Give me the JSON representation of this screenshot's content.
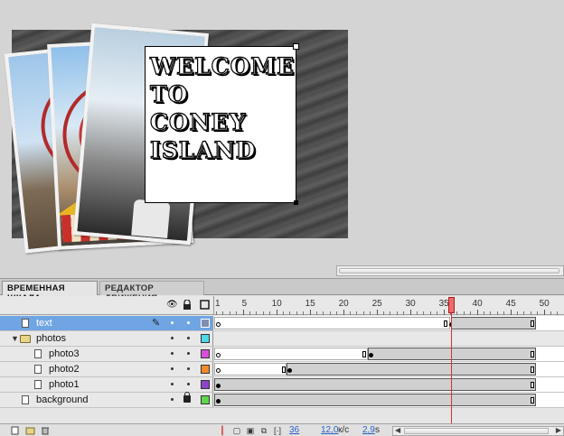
{
  "stage": {
    "text_lines": [
      "WELCOME",
      "TO",
      "CONEY",
      "ISLAND"
    ]
  },
  "tabs": {
    "timeline": "ВРЕМЕННАЯ ШКАЛА",
    "motion_editor": "РЕДАКТОР ДВИЖЕНИЯ"
  },
  "ruler": {
    "labels": [
      "1",
      "5",
      "10",
      "15",
      "20",
      "25",
      "30",
      "35",
      "40",
      "45",
      "50"
    ]
  },
  "layers": [
    {
      "name": "text",
      "color": "#7f8fb0",
      "selected": true,
      "type": "layer"
    },
    {
      "name": "photos",
      "color": "#4ed8e8",
      "selected": false,
      "type": "folder"
    },
    {
      "name": "photo3",
      "color": "#d94fd9",
      "selected": false,
      "type": "layer"
    },
    {
      "name": "photo2",
      "color": "#f08a2a",
      "selected": false,
      "type": "layer"
    },
    {
      "name": "photo1",
      "color": "#8e44c9",
      "selected": false,
      "type": "layer"
    },
    {
      "name": "background",
      "color": "#5cd84a",
      "selected": false,
      "type": "layer"
    }
  ],
  "playhead_frame": 36,
  "footer": {
    "frame": "36",
    "fps_value": "12,0",
    "fps_unit": "к/с",
    "time_value": "2,9",
    "time_unit": "s"
  },
  "colors": {
    "selection": "#6fa5e3",
    "playhead": "#ef6b6b"
  }
}
